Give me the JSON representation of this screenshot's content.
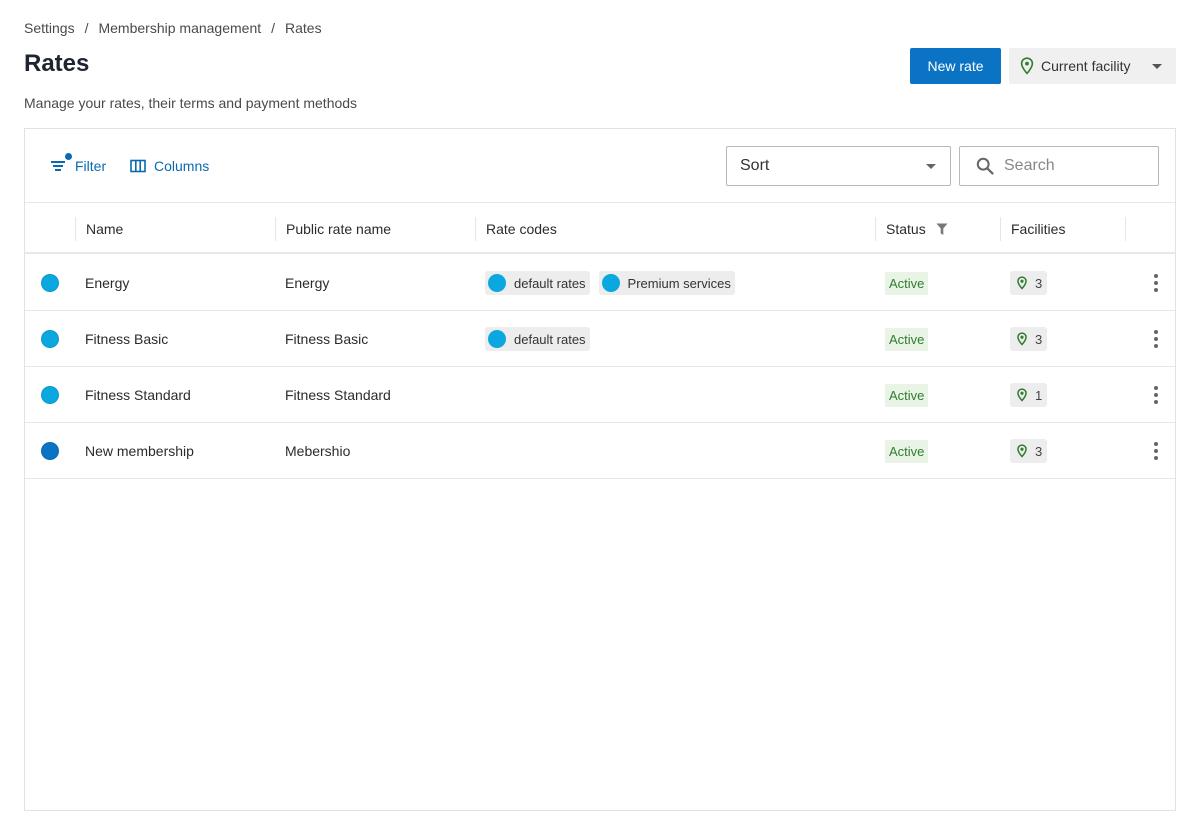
{
  "breadcrumb": {
    "items": [
      "Settings",
      "Membership management",
      "Rates"
    ],
    "separator": "/"
  },
  "header": {
    "title": "Rates",
    "subtitle": "Manage your rates, their terms and payment methods",
    "new_rate_label": "New rate",
    "facility_label": "Current facility"
  },
  "toolbar": {
    "filter_label": "Filter",
    "columns_label": "Columns",
    "sort_label": "Sort",
    "search_placeholder": "Search"
  },
  "table": {
    "columns": [
      "Name",
      "Public rate name",
      "Rate codes",
      "Status",
      "Facilities"
    ],
    "rows": [
      {
        "color": "#0ba8e0",
        "name": "Energy",
        "public_name": "Energy",
        "codes": [
          "default rates",
          "Premium services"
        ],
        "status": "Active",
        "facilities": "3"
      },
      {
        "color": "#0ba8e0",
        "name": "Fitness Basic",
        "public_name": "Fitness Basic",
        "codes": [
          "default rates"
        ],
        "status": "Active",
        "facilities": "3"
      },
      {
        "color": "#0ba8e0",
        "name": "Fitness Standard",
        "public_name": "Fitness Standard",
        "codes": [],
        "status": "Active",
        "facilities": "1"
      },
      {
        "color": "#0a73c4",
        "name": "New membership",
        "public_name": "Mebershio",
        "codes": [],
        "status": "Active",
        "facilities": "3"
      }
    ]
  },
  "colors": {
    "primary": "#0a73c4",
    "link": "#0a6ab0",
    "status_active_bg": "#eaf4e6",
    "status_active_text": "#2f7d2f",
    "facility_pin": "#2f7d2f"
  }
}
